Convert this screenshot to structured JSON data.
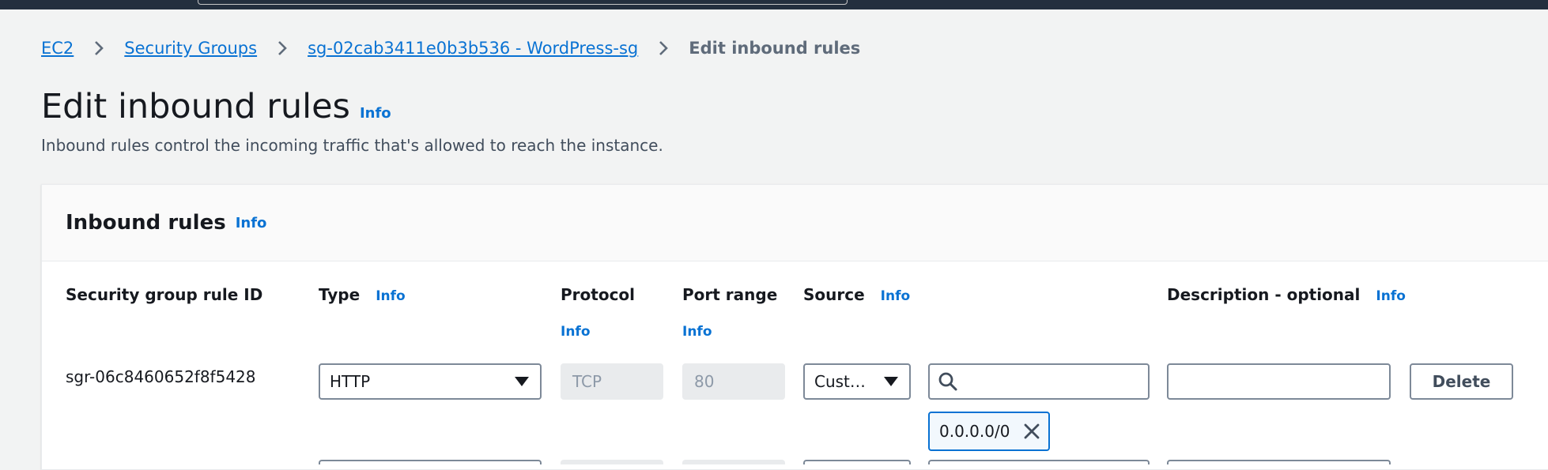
{
  "breadcrumb": {
    "items": [
      "EC2",
      "Security Groups",
      "sg-02cab3411e0b3b536 - WordPress-sg"
    ],
    "current": "Edit inbound rules"
  },
  "page": {
    "title": "Edit inbound rules",
    "info": "Info",
    "description": "Inbound rules control the incoming traffic that's allowed to reach the instance."
  },
  "panel": {
    "title": "Inbound rules",
    "info": "Info"
  },
  "columns": {
    "rule_id": "Security group rule ID",
    "type": "Type",
    "type_info": "Info",
    "protocol": "Protocol",
    "protocol_info": "Info",
    "port_range": "Port range",
    "port_range_info": "Info",
    "source": "Source",
    "source_info": "Info",
    "description": "Description - optional",
    "description_info": "Info"
  },
  "rule": {
    "id": "sgr-06c8460652f8f5428",
    "type": "HTTP",
    "protocol": "TCP",
    "port_range": "80",
    "source": "Cust…",
    "source_search_value": "",
    "description_value": "",
    "delete_label": "Delete",
    "cidr_token": "0.0.0.0/0"
  },
  "icons": {
    "breadcrumb_separator": "chevron-right-icon",
    "select_caret": "caret-down-icon",
    "search": "search-icon",
    "remove_token": "close-icon"
  },
  "colors": {
    "link": "#0972d3",
    "topbar": "#232f3e",
    "background": "#f2f3f3",
    "text": "#16191f"
  }
}
